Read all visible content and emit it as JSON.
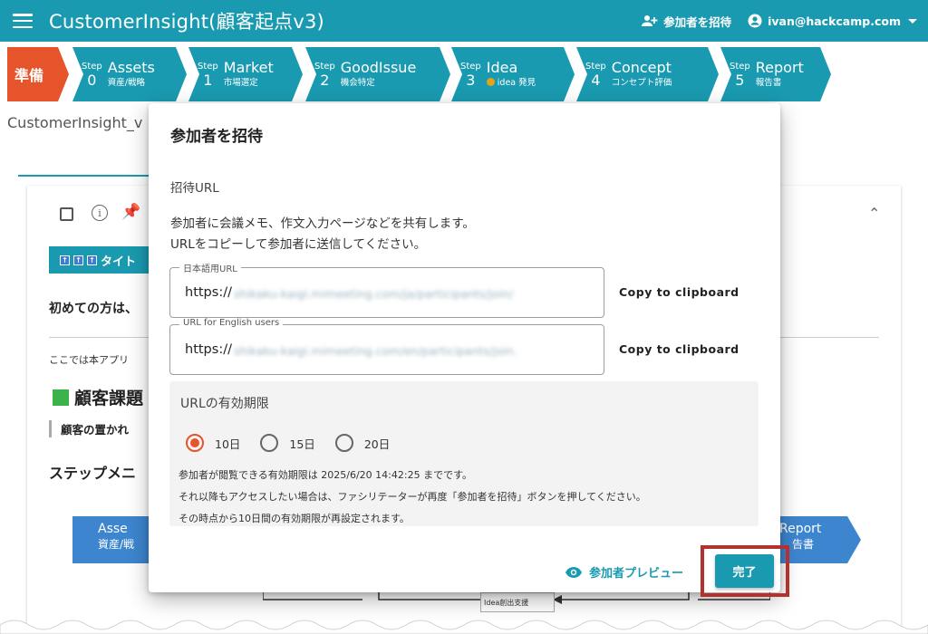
{
  "app": {
    "title": "CustomerInsight(顧客起点v3)",
    "invite_label": "参加者を招待",
    "user_email": "ivan@hackcamp.com"
  },
  "steps": [
    {
      "prefix": "",
      "num": "",
      "label": "準備",
      "sub": ""
    },
    {
      "prefix": "Step",
      "num": "0",
      "label": "Assets",
      "sub": "資産/戦略"
    },
    {
      "prefix": "Step",
      "num": "1",
      "label": "Market",
      "sub": "市場選定"
    },
    {
      "prefix": "Step",
      "num": "2",
      "label": "GoodIssue",
      "sub": "機会特定"
    },
    {
      "prefix": "Step",
      "num": "3",
      "label": "Idea",
      "sub": "idea 発見"
    },
    {
      "prefix": "Step",
      "num": "4",
      "label": "Concept",
      "sub": "コンセプト評価"
    },
    {
      "prefix": "Step",
      "num": "5",
      "label": "Report",
      "sub": "報告書"
    }
  ],
  "background": {
    "page_title": "CustomerInsight_v",
    "banner_text": "タイト",
    "first_time": "初めての方は、",
    "here_text": "ここでは本アプリ",
    "heading": "顧客課題",
    "situation": "顧客の置かれ",
    "step_menu": "ステップメニ",
    "flow_left_title": "Asse",
    "flow_left_sub": "資産/戦",
    "flow_right_title": "Report",
    "flow_right_sub": "告書",
    "flow_bottom": "Idea創出支援"
  },
  "modal": {
    "title": "参加者を招待",
    "section": "招待URL",
    "desc_line1": "参加者に会議メモ、作文入力ページなどを共有します。",
    "desc_line2": "URLをコピーして参加者に送信してください。",
    "url_ja_label": "日本語用URL",
    "url_ja_prefix": "https://",
    "url_ja_rest": "shikaku-kaigi.mimeeting.com/ja/participants/join/",
    "url_en_label": "URL for English users",
    "url_en_prefix": "https://",
    "url_en_rest": "shikaku-kaigi.mimeeting.com/en/participants/join.",
    "copy_label": "Copy to clipboard",
    "expiry_title": "URLの有効期限",
    "options": [
      "10日",
      "15日",
      "20日"
    ],
    "selected_option": "10日",
    "note1": "参加者が閲覧できる有効期限は 2025/6/20 14:42:25 までです。",
    "note2": "それ以降もアクセスしたい場合は、ファシリテーターが再度「参加者を招待」ボタンを押してください。",
    "note3": "その時点から10日間の有効期限が再設定されます。",
    "preview_label": "参加者プレビュー",
    "done_label": "完了"
  },
  "colors": {
    "primary": "#1a9ab0",
    "prep": "#e5542a",
    "highlight": "#b3322d"
  }
}
